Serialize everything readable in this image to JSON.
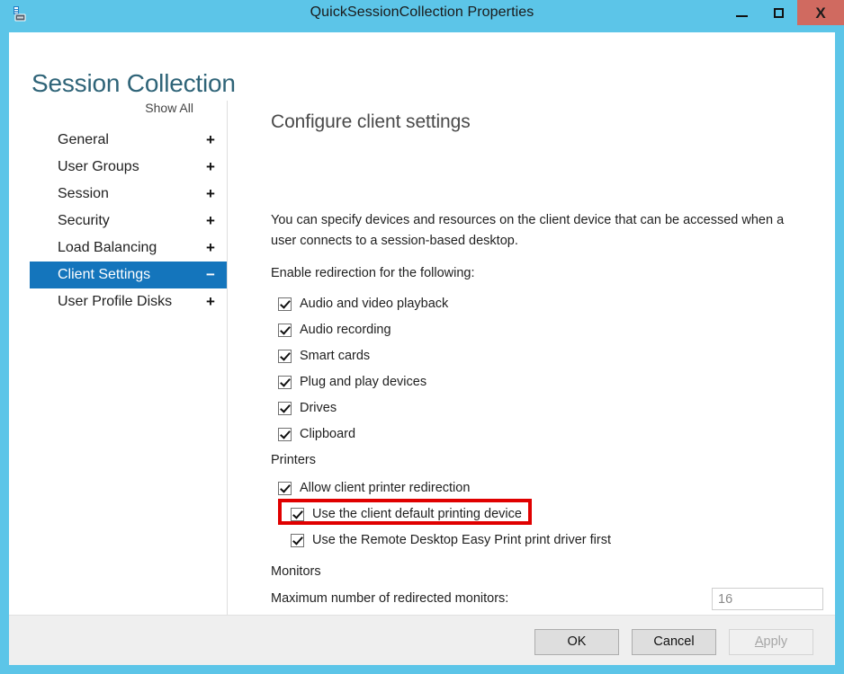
{
  "window": {
    "title": "QuickSessionCollection Properties",
    "icon": "server-properties-icon",
    "minimize_label": "Minimize",
    "maximize_label": "Maximize",
    "close_label": "X",
    "titlebar_color": "#5cc5e8",
    "close_color": "#d06a60"
  },
  "page": {
    "heading": "Session Collection"
  },
  "nav": {
    "show_all": "Show All",
    "selected_color": "#1475bc",
    "items": [
      {
        "label": "General",
        "sign": "+",
        "selected": false
      },
      {
        "label": "User Groups",
        "sign": "+",
        "selected": false
      },
      {
        "label": "Session",
        "sign": "+",
        "selected": false
      },
      {
        "label": "Security",
        "sign": "+",
        "selected": false
      },
      {
        "label": "Load Balancing",
        "sign": "+",
        "selected": false
      },
      {
        "label": "Client Settings",
        "sign": "−",
        "selected": true
      },
      {
        "label": "User Profile Disks",
        "sign": "+",
        "selected": false
      }
    ]
  },
  "content": {
    "heading": "Configure client settings",
    "intro": "You can specify devices and resources on the client device that can be accessed when a user connects to a session-based desktop.",
    "enable_label": "Enable redirection for the following:",
    "redirection": [
      {
        "label": "Audio and video playback",
        "checked": true
      },
      {
        "label": "Audio recording",
        "checked": true
      },
      {
        "label": "Smart cards",
        "checked": true
      },
      {
        "label": "Plug and play devices",
        "checked": true
      },
      {
        "label": "Drives",
        "checked": true
      },
      {
        "label": "Clipboard",
        "checked": true
      }
    ],
    "printers_label": "Printers",
    "printers": [
      {
        "label": "Allow client printer redirection",
        "checked": true,
        "indent": false,
        "highlighted": false
      },
      {
        "label": "Use the client default printing device",
        "checked": true,
        "indent": true,
        "highlighted": true
      },
      {
        "label": "Use the Remote Desktop Easy Print print driver first",
        "checked": true,
        "indent": true,
        "highlighted": false
      }
    ],
    "monitors_label": "Monitors",
    "monitors_field_label": "Maximum number of redirected monitors:",
    "monitors_value": "16",
    "highlight_color": "#e00000"
  },
  "footer": {
    "ok": "OK",
    "cancel": "Cancel",
    "apply_accel": "A",
    "apply_rest": "pply",
    "apply_disabled": true
  }
}
